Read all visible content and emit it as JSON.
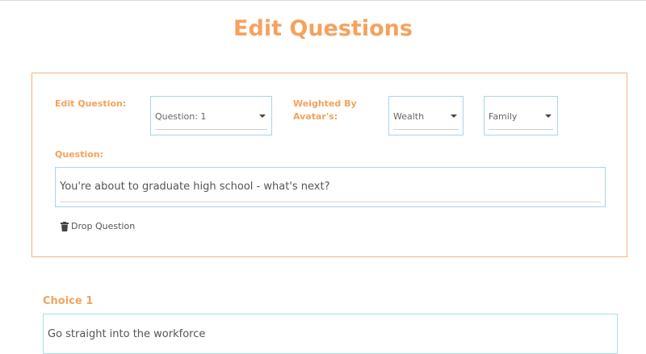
{
  "page": {
    "title": "Edit Questions"
  },
  "edit_question": {
    "label": "Edit Question:",
    "question_select": {
      "value": "Question: 1"
    },
    "weighted_label_line1": "Weighted By",
    "weighted_label_line2": "Avatar's:",
    "wealth_select": {
      "value": "Wealth"
    },
    "family_select": {
      "value": "Family"
    },
    "question_label": "Question:",
    "question_text": "You're about to graduate high school - what's next?",
    "drop_label": "Drop Question"
  },
  "choices": [
    {
      "label": "Choice 1",
      "value": "Go straight into the workforce"
    }
  ],
  "colors": {
    "accent": "#f5a25d",
    "field_border": "#a9d4ec"
  },
  "icons": {
    "drop": "trash-icon",
    "dropdown": "caret-down-icon"
  }
}
